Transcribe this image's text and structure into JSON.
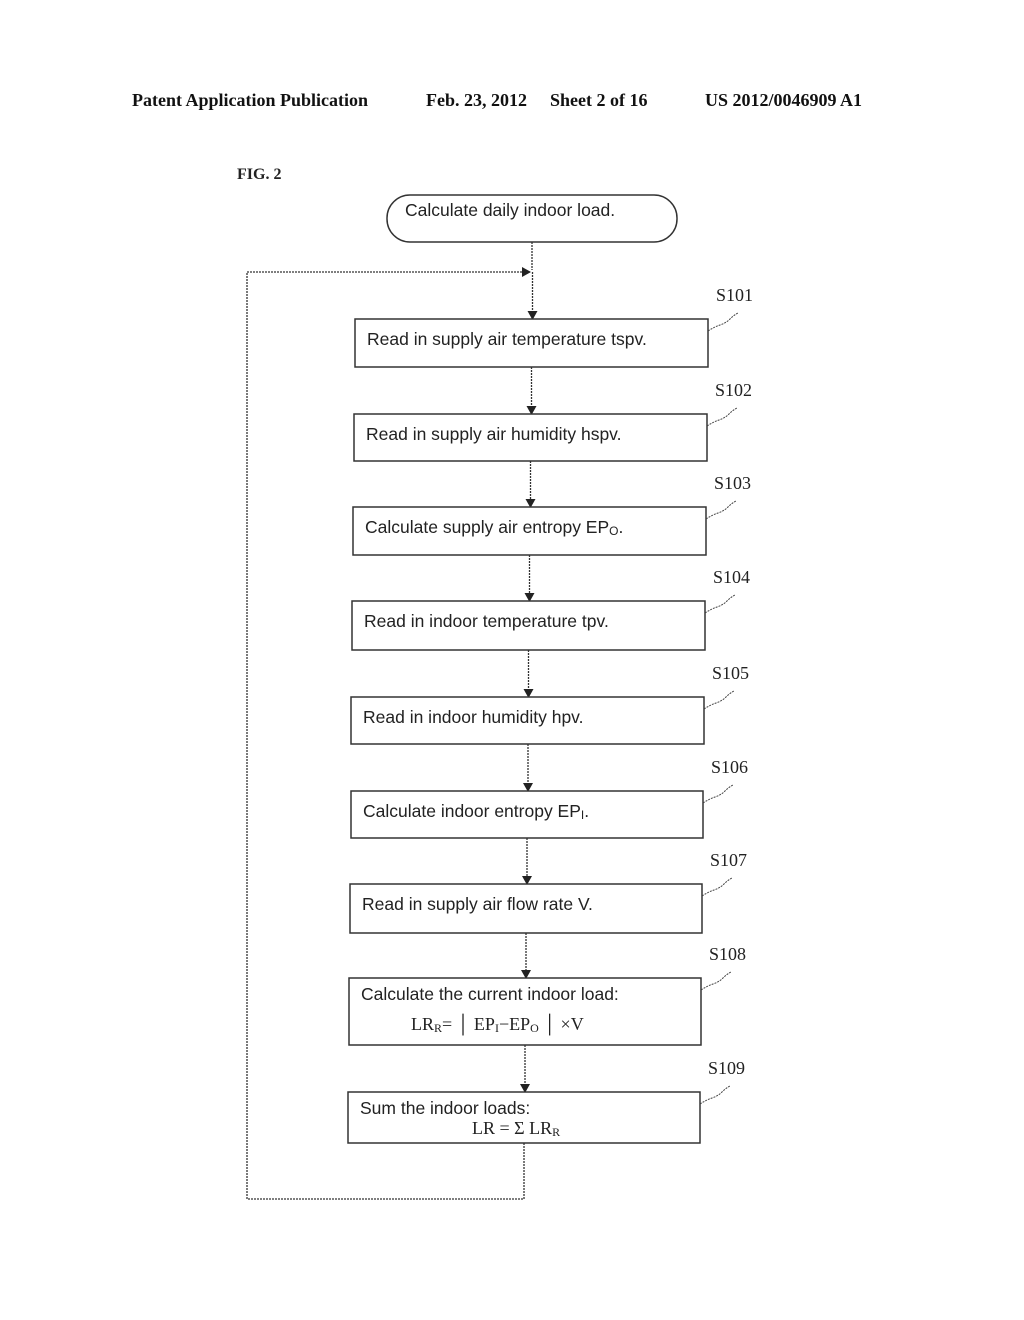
{
  "header": {
    "publication_type": "Patent Application Publication",
    "date": "Feb. 23, 2012",
    "sheet": "Sheet 2 of 16",
    "publication_number": "US 2012/0046909 A1"
  },
  "figure": {
    "label": "FIG. 2",
    "start": {
      "text": "Calculate daily indoor load."
    },
    "steps": [
      {
        "id": "S101",
        "text": "Read in supply air temperature tspv."
      },
      {
        "id": "S102",
        "text": "Read in supply air humidity hspv."
      },
      {
        "id": "S103",
        "text": "Calculate supply air entropy EP",
        "sub": "O",
        "suffix": "."
      },
      {
        "id": "S104",
        "text": "Read in indoor temperature tpv."
      },
      {
        "id": "S105",
        "text": "Read in indoor humidity hpv."
      },
      {
        "id": "S106",
        "text": "Calculate indoor entropy EP",
        "sub": "I",
        "suffix": "."
      },
      {
        "id": "S107",
        "text": "Read in supply air flow rate V."
      },
      {
        "id": "S108",
        "text": "Calculate the current indoor load:",
        "formula": "LR_R = | EP_I − EP_O | × V",
        "formula_parts": [
          "LR",
          "R",
          "= │ EP",
          "I",
          "−EP",
          "O",
          " │ ×V"
        ]
      },
      {
        "id": "S109",
        "text": "Sum the indoor loads:",
        "formula": "LR = Σ LR_R",
        "formula_parts": [
          "LR = Σ LR",
          "R"
        ]
      }
    ],
    "loop": "return from S109 to before S101"
  }
}
